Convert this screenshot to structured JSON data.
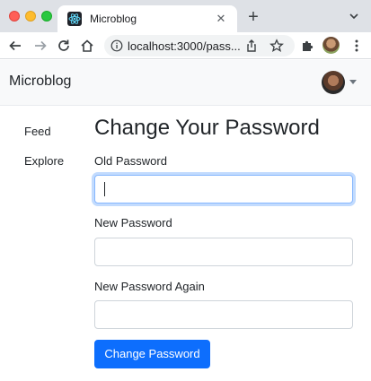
{
  "browser": {
    "tab": {
      "title": "Microblog",
      "favicon": "react-atom-icon"
    },
    "address_bar": {
      "url": "localhost:3000/pass..."
    },
    "colors": {
      "chrome": "#dee1e6",
      "omnibox": "#f1f3f4"
    }
  },
  "navbar": {
    "brand": "Microblog",
    "avatar": "user-avatar"
  },
  "sidebar": {
    "items": [
      {
        "label": "Feed"
      },
      {
        "label": "Explore"
      }
    ]
  },
  "main": {
    "title": "Change Your Password",
    "fields": [
      {
        "label": "Old Password",
        "value": "",
        "focused": true
      },
      {
        "label": "New Password",
        "value": ""
      },
      {
        "label": "New Password Again",
        "value": ""
      }
    ],
    "submit_label": "Change Password"
  },
  "colors": {
    "primary": "#0d6efd",
    "navbar_bg": "#f8f9fa",
    "focus_border": "#86b7fe"
  }
}
